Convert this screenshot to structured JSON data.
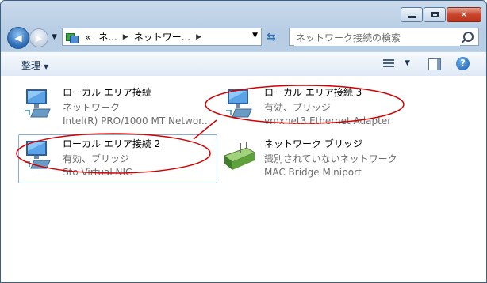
{
  "addressbar": {
    "crumbs": [
      "«",
      "ネ...",
      "ネットワー..."
    ],
    "search_placeholder": "ネットワーク接続の検索"
  },
  "toolbar": {
    "organize_label": "整理",
    "organize_arrow": "▼",
    "view_arrow": "▼",
    "help_glyph": "?"
  },
  "connections": [
    {
      "name": "ローカル エリア接続",
      "status": "ネットワーク",
      "adapter": "Intel(R) PRO/1000 MT Networ...",
      "icon": "network-adapter-icon"
    },
    {
      "name": "ローカル エリア接続 3",
      "status": "有効、ブリッジ",
      "adapter": "vmxnet3 Ethernet Adapter",
      "icon": "network-adapter-icon"
    },
    {
      "name": "ローカル エリア接続 2",
      "status": "有効、ブリッジ",
      "adapter": "Sto Virtual NIC",
      "icon": "network-adapter-icon",
      "selected": true
    },
    {
      "name": "ネットワーク ブリッジ",
      "status": "識別されていないネットワーク",
      "adapter": "MAC Bridge Miniport",
      "icon": "network-bridge-icon"
    }
  ],
  "colors": {
    "annotation": "#d40000",
    "selection": "#84acdd",
    "secondary_text": "#6d6d6d"
  }
}
